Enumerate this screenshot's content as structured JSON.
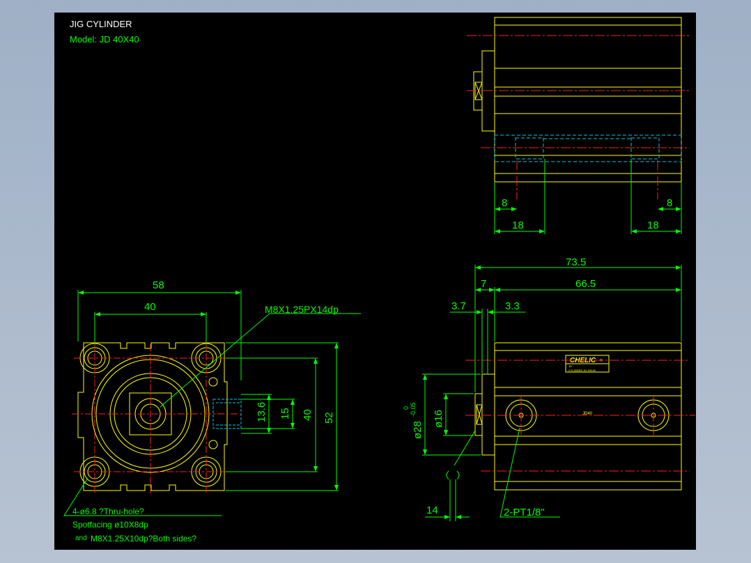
{
  "title": {
    "line1": "JIG CYLINDER",
    "line2": "Model:  JD  40X40"
  },
  "colors": {
    "sheet_bg": "#000000",
    "outline": "#ffff00",
    "dimension": "#00ff00",
    "centerline": "#ff2020",
    "hidden": "#00c8e6",
    "title_text": "#ffffff"
  },
  "top_view": {
    "dims": {
      "left_8": "8",
      "right_8": "8",
      "left_18": "18",
      "right_18": "18"
    }
  },
  "front_view": {
    "dims": {
      "w58": "58",
      "w40": "40",
      "h13_6": "13.6",
      "h15": "15",
      "h40": "40",
      "h52": "52"
    },
    "thread_note": "M8X1.25PX14dp",
    "hole_note": {
      "line1": "4-ø6.8  ?Thru-hole?",
      "line2": "Spotfacing  ø10X8dp",
      "line3_prefix": "and",
      "line3": "M8X1.25X10dp?Both sides?"
    }
  },
  "side_view": {
    "dims": {
      "d73_5": "73.5",
      "d7": "7",
      "d66_5": "66.5",
      "d3_7": "3.7",
      "d3_3": "3.3",
      "d14": "14",
      "d16": "ø16"
    },
    "dia28": "ø28",
    "tol_upper": "0",
    "tol_lower": "-0.05",
    "port_note": "2-PT1/8\"",
    "label_brand": "CHELIC",
    "label_suffix": "®",
    "label_small_1": "JD",
    "label_small_2": "CYLINDER JD 40X40",
    "body_text": "JD40"
  }
}
